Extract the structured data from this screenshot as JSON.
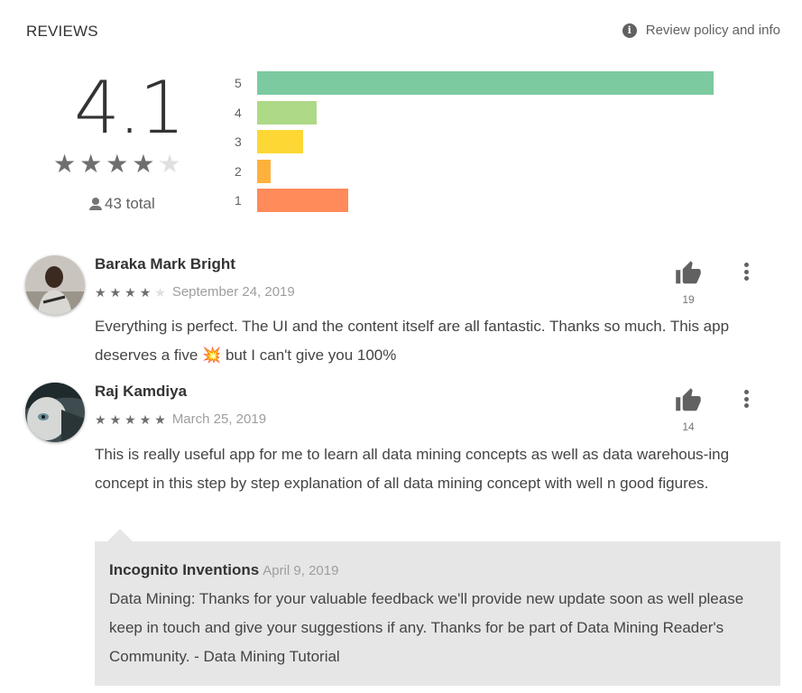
{
  "header": {
    "title": "REVIEWS",
    "policy_link": "Review policy and info",
    "info_icon": "i"
  },
  "summary": {
    "score": "4.1",
    "rating": 4.1,
    "total": "43 total"
  },
  "distribution": [
    {
      "label": "5",
      "fraction": 1.0,
      "color": "#7bcaa0"
    },
    {
      "label": "4",
      "fraction": 0.13,
      "color": "#aed987"
    },
    {
      "label": "3",
      "fraction": 0.1,
      "color": "#fdd835"
    },
    {
      "label": "2",
      "fraction": 0.03,
      "color": "#ffb13b"
    },
    {
      "label": "1",
      "fraction": 0.2,
      "color": "#ff8a5a"
    }
  ],
  "reviews": [
    {
      "author": "Baraka Mark Bright",
      "stars": 4,
      "date": "September 24, 2019",
      "text": "Everything is perfect. The UI and the content itself are all fantastic. Thanks so much. This app deserves a five 💥 but I can't give you 100%",
      "likes": "19"
    },
    {
      "author": "Raj Kamdiya",
      "stars": 5,
      "date": "March 25, 2019",
      "text": "This is really useful app for me to learn all data mining concepts as well as data warehous-ing concept in this step by step explanation of all data mining concept with well n good figures.",
      "likes": "14"
    }
  ],
  "reply": {
    "author": "Incognito Inventions",
    "date": "April 9, 2019",
    "text": "Data Mining: Thanks for your valuable feedback we'll provide new update soon as well please keep in touch and give your suggestions if any. Thanks for be part of Data Mining Reader's Community. - Data Mining Tutorial"
  },
  "colors": {
    "star_filled": "#6f6f6f",
    "star_empty": "#e0e0e0"
  }
}
